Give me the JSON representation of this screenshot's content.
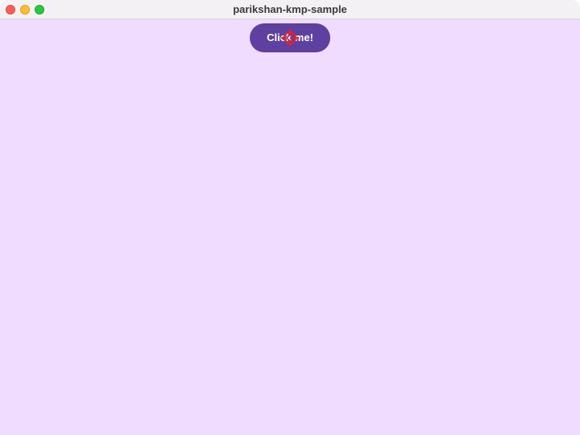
{
  "window": {
    "title": "parikshan-kmp-sample"
  },
  "main": {
    "button_label": "Click me!"
  },
  "colors": {
    "background": "#f0dcff",
    "button": "#5e40a1",
    "button_text": "#ffffff",
    "cursor_marker": "#e8202a"
  },
  "icons": {
    "cursor": "crosshair-target-icon"
  }
}
